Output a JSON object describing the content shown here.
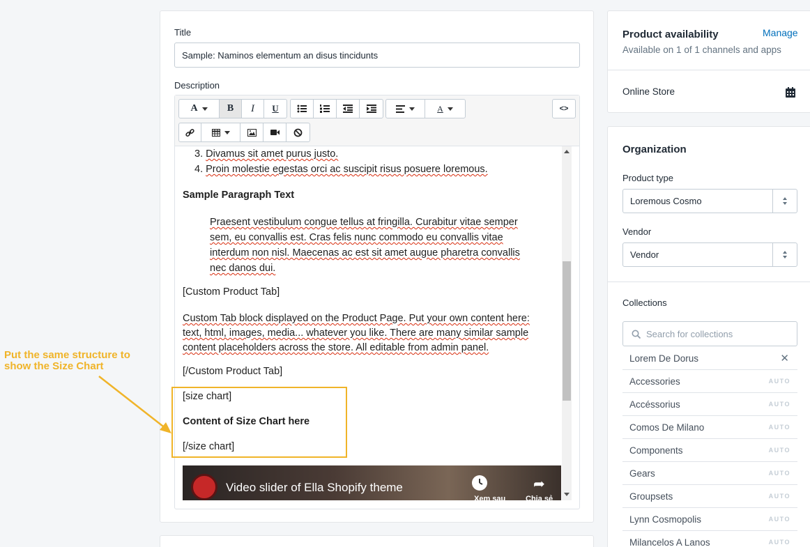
{
  "main": {
    "title_label": "Title",
    "title_value": "Sample: Naminos elementum  an disus tincidunts",
    "description_label": "Description"
  },
  "toolbar": {
    "font_btn": "A",
    "bold_btn": "B",
    "italic_btn": "I",
    "underline_btn": "U",
    "color_btn": "A",
    "code_btn": "<>"
  },
  "editor": {
    "list_items": [
      {
        "num": "3.",
        "text": "Divamus sit amet purus justo."
      },
      {
        "num": "4.",
        "text": "Proin molestie egestas orci ac suscipit risus posuere loremous."
      }
    ],
    "para_heading": "Sample Paragraph Text",
    "para_lines": [
      "Praesent vestibulum congue tellus at fringilla. Curabitur vitae semper",
      "sem, eu convallis est. Cras felis nunc commodo eu convallis vitae",
      "interdum non nisl. Maecenas ac est sit amet augue pharetra convallis",
      "nec danos dui."
    ],
    "tab_open": "[Custom Product Tab]",
    "tab_lines": [
      "Custom Tab block displayed on the Product Page. Put your own content here:",
      "text, html, images, media... whatever you like. There are many similar sample",
      "content placeholders across the store. All editable from admin panel."
    ],
    "tab_close": "[/Custom Product Tab]",
    "size_open": "[size chart]",
    "size_content": "Content of Size Chart here",
    "size_close": "[/size chart]",
    "video_title": "Video slider of Ella Shopify theme",
    "video_watch_later": "Xem sau",
    "video_share": "Chia sẻ"
  },
  "availability": {
    "title": "Product availability",
    "manage": "Manage",
    "subtitle": "Available on 1 of 1 channels and apps",
    "channel": "Online Store"
  },
  "organization": {
    "title": "Organization",
    "product_type_label": "Product type",
    "product_type_value": "Loremous Cosmo",
    "vendor_label": "Vendor",
    "vendor_value": "Vendor",
    "collections_label": "Collections",
    "search_placeholder": "Search for collections",
    "selected_collection": "Lorem De Dorus",
    "auto_badge": "AUTO",
    "collections": [
      "Accessories",
      "Accéssorius",
      "Comos De Milano",
      "Components",
      "Gears",
      "Groupsets",
      "Lynn Cosmopolis",
      "Milancelos A Lanos"
    ]
  },
  "annotation": {
    "line1": "Put the same structure to",
    "line2": "show the Size Chart"
  },
  "colors": {
    "accent": "#006fbb",
    "annotation": "#f0b429",
    "spell_error": "#d82c0d"
  }
}
